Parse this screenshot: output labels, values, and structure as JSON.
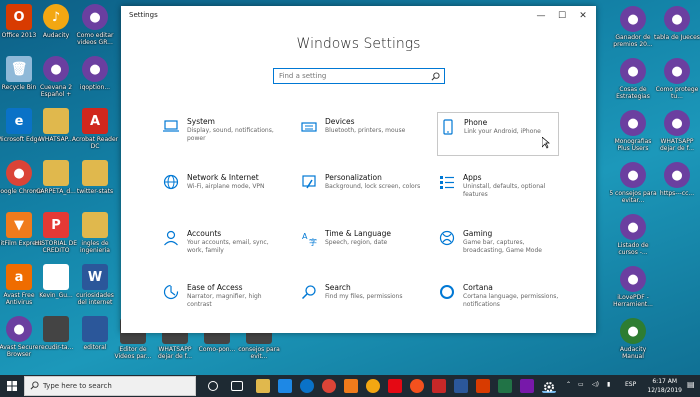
{
  "desktop": {
    "left_icons": [
      {
        "label": "Office 2013",
        "color": "#d83b01",
        "glyph": "O"
      },
      {
        "label": "Audacity",
        "color": "#f3a712",
        "glyph": "♪",
        "circle": true
      },
      {
        "label": "Como editar videos GR...",
        "color": "#6b3fa0",
        "glyph": "●",
        "circle": true
      },
      {
        "label": "Recycle Bin",
        "color": "#8fb9d8",
        "glyph": "🗑"
      },
      {
        "label": "Cuevana 2 Español +",
        "color": "#6b3fa0",
        "glyph": "●",
        "circle": true
      },
      {
        "label": "iqoption...",
        "color": "#6b3fa0",
        "glyph": "●",
        "circle": true
      },
      {
        "label": "Microsoft Edge",
        "color": "#0a72c7",
        "glyph": "e"
      },
      {
        "label": "WHATSAP...",
        "color": "#e0b84d",
        "glyph": ""
      },
      {
        "label": "Acrobat Reader DC",
        "color": "#d0271d",
        "glyph": "A"
      },
      {
        "label": "Google Chrome",
        "color": "#db4437",
        "glyph": "●",
        "circle": true
      },
      {
        "label": "CARPETA_d...",
        "color": "#e0b84d",
        "glyph": ""
      },
      {
        "label": "twitter-stats",
        "color": "#e0b84d",
        "glyph": ""
      },
      {
        "label": "HitFilm Express",
        "color": "#f07b1c",
        "glyph": "▼"
      },
      {
        "label": "HISTORIAL DE CREDITO",
        "color": "#e53935",
        "glyph": "P"
      },
      {
        "label": "ingles de ingenieria",
        "color": "#e0b84d",
        "glyph": ""
      },
      {
        "label": "Avast Free Antivirus",
        "color": "#ef6c00",
        "glyph": "a"
      },
      {
        "label": "Kevin_Gu...",
        "color": "#ffffff",
        "glyph": ""
      },
      {
        "label": "curiosidades del internet",
        "color": "#2b579a",
        "glyph": "W"
      },
      {
        "label": "Avast Secure Browser",
        "color": "#6b3fa0",
        "glyph": "●",
        "circle": true
      },
      {
        "label": "recudir-ta...",
        "color": "#444444",
        "glyph": ""
      },
      {
        "label": "editoral",
        "color": "#2b579a",
        "glyph": ""
      }
    ],
    "bottom_icons": [
      {
        "label": "Editor de Videos par...",
        "color": "#444444"
      },
      {
        "label": "WHATSAPP dejar de f...",
        "color": "#444444"
      },
      {
        "label": "Como-pon...",
        "color": "#444444"
      },
      {
        "label": "consejos para evit...",
        "color": "#444444"
      }
    ],
    "right_icons": [
      {
        "label": "Ganador de premios 20...",
        "color": "#6b3fa0",
        "glyph": "●",
        "circle": true
      },
      {
        "label": "tabla de Jueces",
        "color": "#6b3fa0",
        "glyph": "●",
        "circle": true
      },
      {
        "label": "Cosas de Estrategias",
        "color": "#6b3fa0",
        "glyph": "●",
        "circle": true
      },
      {
        "label": "Como protege tu...",
        "color": "#6b3fa0",
        "glyph": "●",
        "circle": true
      },
      {
        "label": "Monografias Plus Users",
        "color": "#6b3fa0",
        "glyph": "●",
        "circle": true
      },
      {
        "label": "WHATSAPP dejar de f...",
        "color": "#6b3fa0",
        "glyph": "●",
        "circle": true
      },
      {
        "label": "5 consejos para evitar...",
        "color": "#6b3fa0",
        "glyph": "●",
        "circle": true
      },
      {
        "label": "https---cc...",
        "color": "#6b3fa0",
        "glyph": "●",
        "circle": true
      },
      {
        "label": "Listado de cursos -...",
        "color": "#6b3fa0",
        "glyph": "●",
        "circle": true
      },
      {
        "label": "iLovePDF - Herramient...",
        "color": "#6b3fa0",
        "glyph": "●",
        "circle": true
      },
      {
        "label": "Audacity Manual",
        "color": "#2e7d32",
        "glyph": "●",
        "circle": true
      }
    ]
  },
  "window": {
    "title": "Settings",
    "minimize": "—",
    "maximize": "☐",
    "close": "✕",
    "heading": "Windows Settings",
    "search_placeholder": "Find a setting"
  },
  "tiles": [
    {
      "name": "System",
      "desc": "Display, sound, notifications, power",
      "icon": "laptop-icon"
    },
    {
      "name": "Devices",
      "desc": "Bluetooth, printers, mouse",
      "icon": "keyboard-icon"
    },
    {
      "name": "Phone",
      "desc": "Link your Android, iPhone",
      "icon": "phone-icon"
    },
    {
      "name": "Network & Internet",
      "desc": "Wi-Fi, airplane mode, VPN",
      "icon": "globe-icon"
    },
    {
      "name": "Personalization",
      "desc": "Background, lock screen, colors",
      "icon": "paintbrush-icon"
    },
    {
      "name": "Apps",
      "desc": "Uninstall, defaults, optional features",
      "icon": "apps-list-icon"
    },
    {
      "name": "Accounts",
      "desc": "Your accounts, email, sync, work, family",
      "icon": "person-icon"
    },
    {
      "name": "Time & Language",
      "desc": "Speech, region, date",
      "icon": "clock-language-icon"
    },
    {
      "name": "Gaming",
      "desc": "Game bar, captures, broadcasting, Game Mode",
      "icon": "xbox-icon"
    },
    {
      "name": "Ease of Access",
      "desc": "Narrator, magnifier, high contrast",
      "icon": "ease-of-access-icon"
    },
    {
      "name": "Search",
      "desc": "Find my files, permissions",
      "icon": "search-icon"
    },
    {
      "name": "Cortana",
      "desc": "Cortana language, permissions, notifications",
      "icon": "cortana-icon"
    }
  ],
  "taskbar": {
    "search_placeholder": "Type here to search",
    "tray_lang": "ESP",
    "time": "6:17 AM",
    "date": "12/18/2019"
  },
  "colors": {
    "accent": "#0078d4",
    "taskbar": "#1e2a33"
  }
}
